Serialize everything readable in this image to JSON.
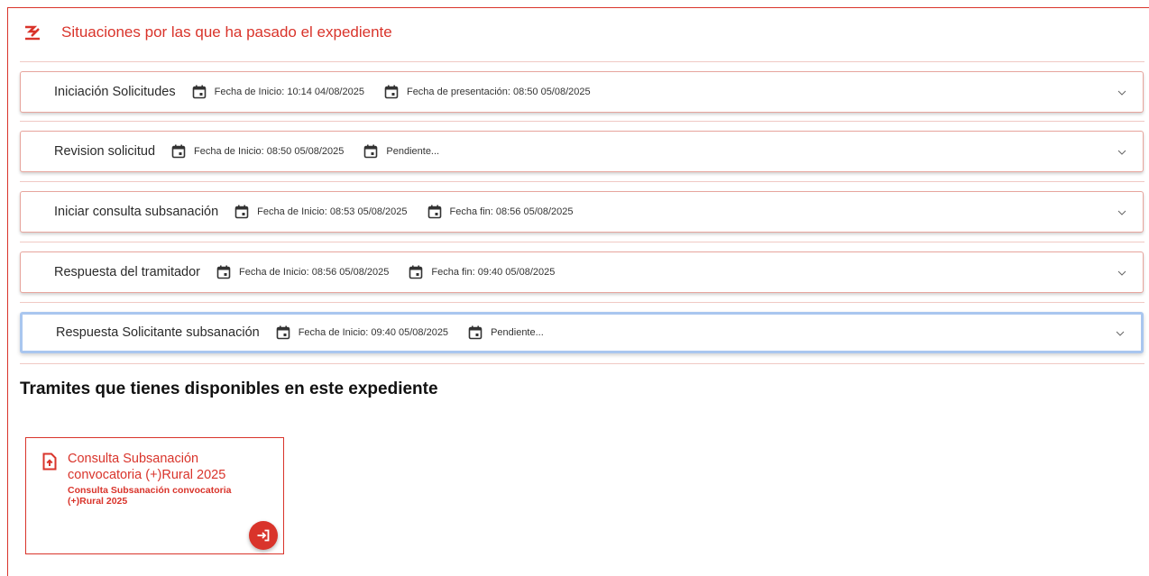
{
  "section": {
    "title": "Situaciones por las que ha pasado el expediente",
    "icon": "signature-icon",
    "accent_color": "#d9342b"
  },
  "situations": [
    {
      "title": "Iniciación Solicitudes",
      "start_label": "Fecha de Inicio: 10:14 04/08/2025",
      "end_label": "Fecha de presentación: 08:50 05/08/2025"
    },
    {
      "title": "Revision solicitud",
      "start_label": "Fecha de Inicio: 08:50 05/08/2025",
      "end_label": "Pendiente..."
    },
    {
      "title": "Iniciar consulta subsanación",
      "start_label": "Fecha de Inicio: 08:53 05/08/2025",
      "end_label": "Fecha fin: 08:56 05/08/2025"
    },
    {
      "title": "Respuesta del tramitador",
      "start_label": "Fecha de Inicio: 08:56 05/08/2025",
      "end_label": "Fecha fin: 09:40 05/08/2025"
    },
    {
      "title": "Respuesta Solicitante subsanación",
      "start_label": "Fecha de Inicio: 09:40 05/08/2025",
      "end_label": "Pendiente..."
    }
  ],
  "tramites": {
    "title": "Tramites que tienes disponibles en este expediente",
    "cards": [
      {
        "title": "Consulta Subsanación convocatoria (+)Rural 2025",
        "subtitle": "Consulta Subsanación convocatoria (+)Rural 2025",
        "icon": "file-upload-icon",
        "action_icon": "login-arrow-icon"
      }
    ]
  }
}
